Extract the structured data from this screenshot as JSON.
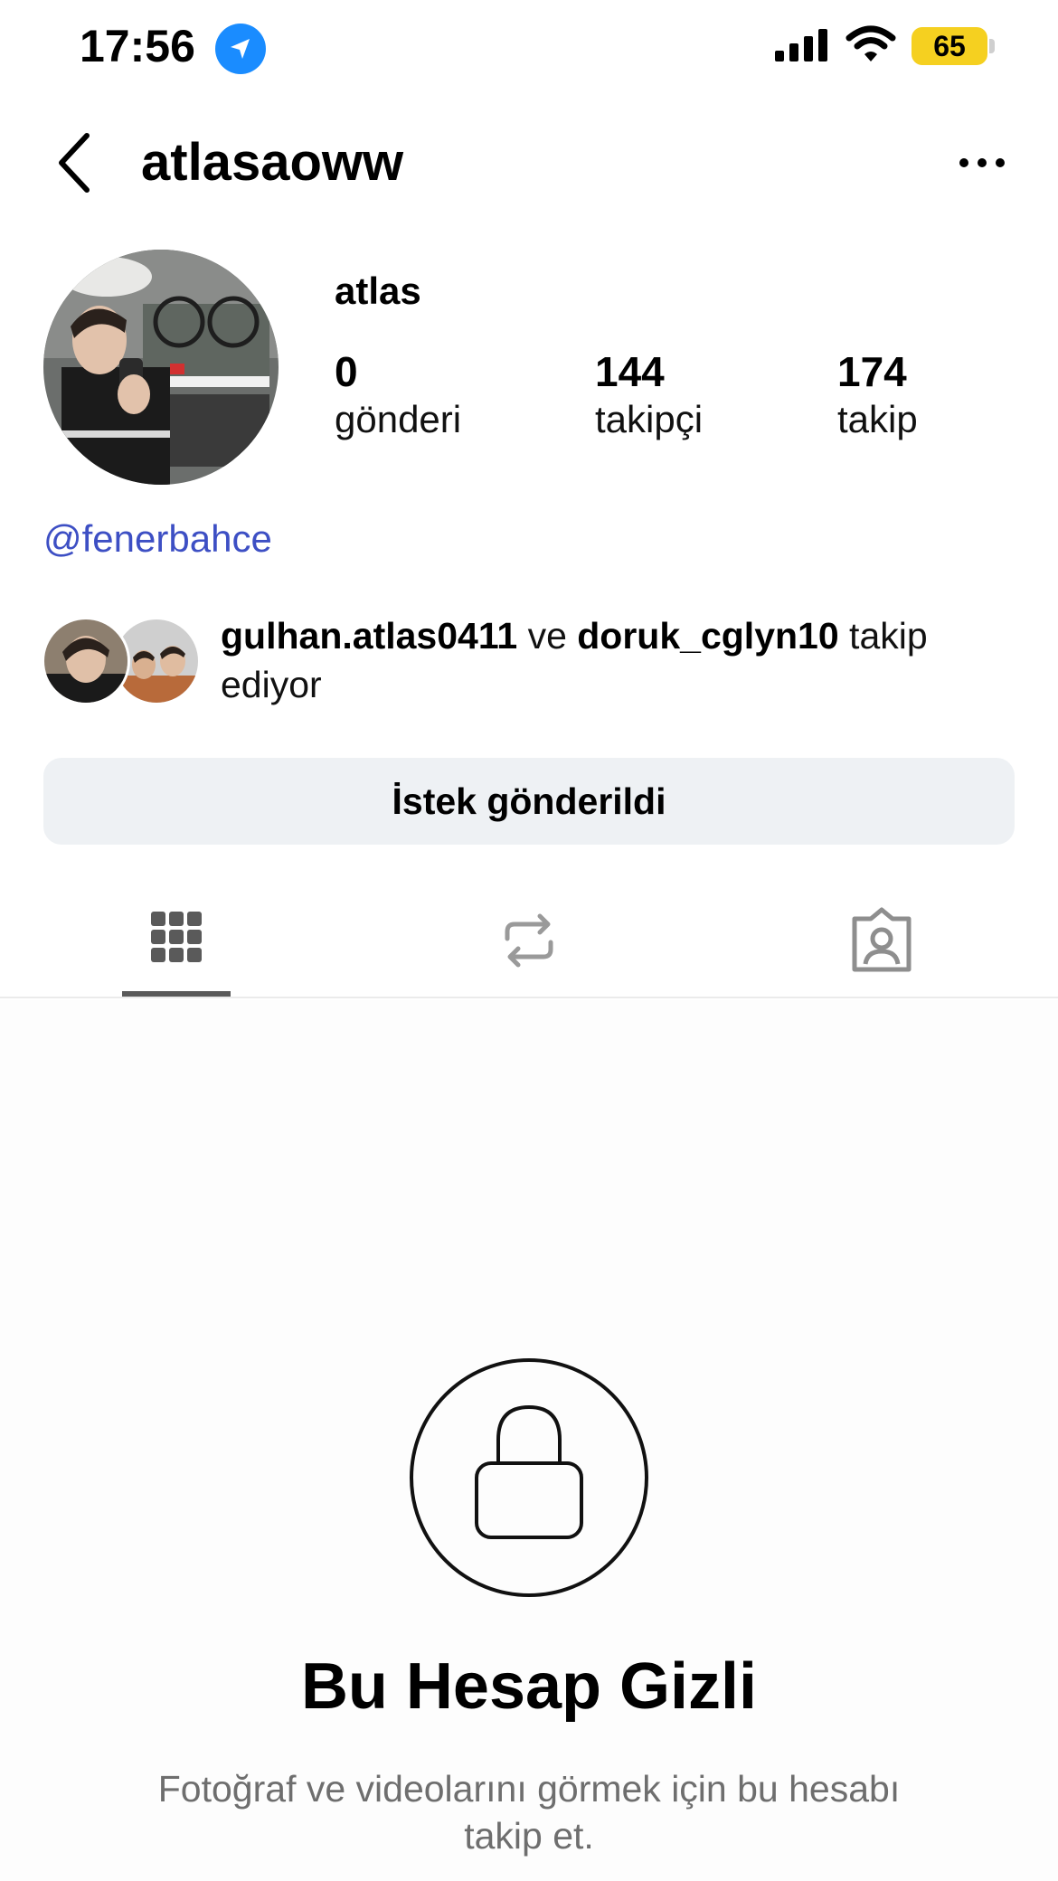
{
  "status_bar": {
    "time": "17:56",
    "battery_level": "65",
    "icons": [
      "location-arrow-icon",
      "cellular-signal-icon",
      "wifi-icon",
      "battery-icon"
    ]
  },
  "header": {
    "username": "atlasaoww",
    "back_icon": "chevron-left-icon",
    "more_icon": "more-horizontal-icon"
  },
  "profile": {
    "display_name": "atlas",
    "stats": [
      {
        "value": "0",
        "label": "gönderi"
      },
      {
        "value": "144",
        "label": "takipçi"
      },
      {
        "value": "174",
        "label": "takip"
      }
    ],
    "bio_mention": "@fenerbahce",
    "followed_by": {
      "user1": "gulhan.atlas0411",
      "connector": " ve ",
      "user2": "doruk_cglyn10",
      "suffix": " takip ediyor"
    }
  },
  "actions": {
    "request_button": "İstek gönderildi"
  },
  "tabs": [
    {
      "icon": "grid-icon",
      "active": true
    },
    {
      "icon": "repost-icon",
      "active": false
    },
    {
      "icon": "tagged-person-icon",
      "active": false
    }
  ],
  "private_notice": {
    "icon": "lock-icon",
    "title": "Bu Hesap Gizli",
    "description": "Fotoğraf ve videolarını görmek için bu hesabı takip et."
  },
  "colors": {
    "mention": "#3d4fc4",
    "location_badge": "#1a8cff",
    "battery": "#f5d020",
    "button_bg": "#eef1f4",
    "muted_text": "#6e6e6e"
  }
}
